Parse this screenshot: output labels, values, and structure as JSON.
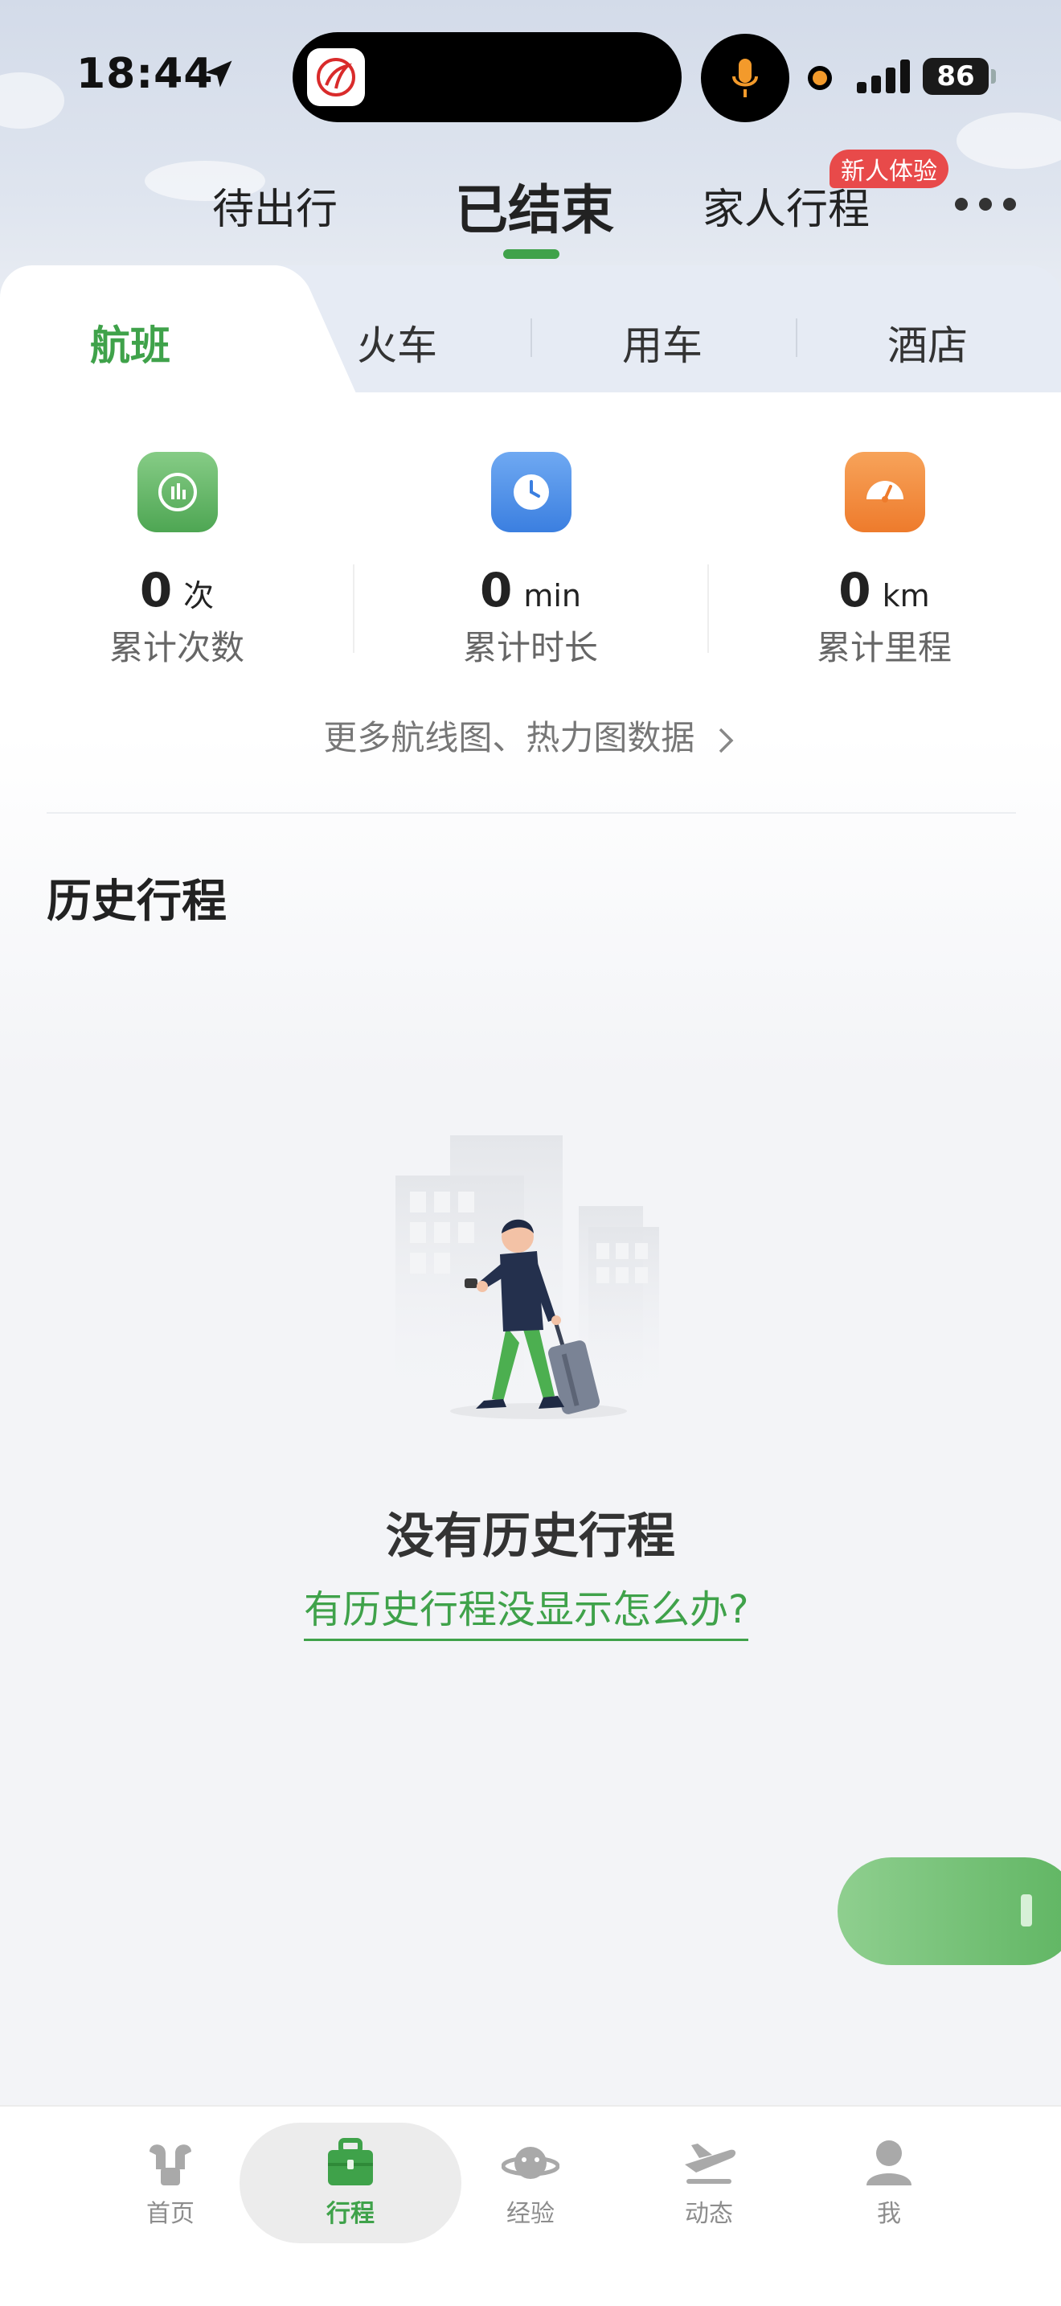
{
  "status_bar": {
    "time": "18:44",
    "battery": "86"
  },
  "top_tabs": {
    "items": [
      {
        "label": "待出行"
      },
      {
        "label": "已结束"
      },
      {
        "label": "家人行程"
      }
    ],
    "active_index": 1,
    "family_badge": "新人体验"
  },
  "segments": {
    "items": [
      {
        "label": "航班"
      },
      {
        "label": "火车"
      },
      {
        "label": "用车"
      },
      {
        "label": "酒店"
      }
    ],
    "active_index": 0
  },
  "stats": [
    {
      "value": "0",
      "unit": "次",
      "label": "累计次数",
      "icon": "bar-chart-icon",
      "color": "#5fb562"
    },
    {
      "value": "0",
      "unit": "min",
      "label": "累计时长",
      "icon": "clock-icon",
      "color": "#4a8de8"
    },
    {
      "value": "0",
      "unit": "km",
      "label": "累计里程",
      "icon": "speedometer-icon",
      "color": "#f08a3a"
    }
  ],
  "more_data_link": "更多航线图、热力图数据",
  "history": {
    "title": "历史行程",
    "empty_title": "没有历史行程",
    "help_link": "有历史行程没显示怎么办?"
  },
  "tabbar": {
    "items": [
      {
        "label": "首页",
        "icon": "home-icon"
      },
      {
        "label": "行程",
        "icon": "suitcase-icon"
      },
      {
        "label": "经验",
        "icon": "planet-icon"
      },
      {
        "label": "动态",
        "icon": "plane-icon"
      },
      {
        "label": "我",
        "icon": "user-icon"
      }
    ],
    "active_index": 1
  },
  "colors": {
    "accent": "#3fa24a",
    "badge": "#e84a4a"
  }
}
